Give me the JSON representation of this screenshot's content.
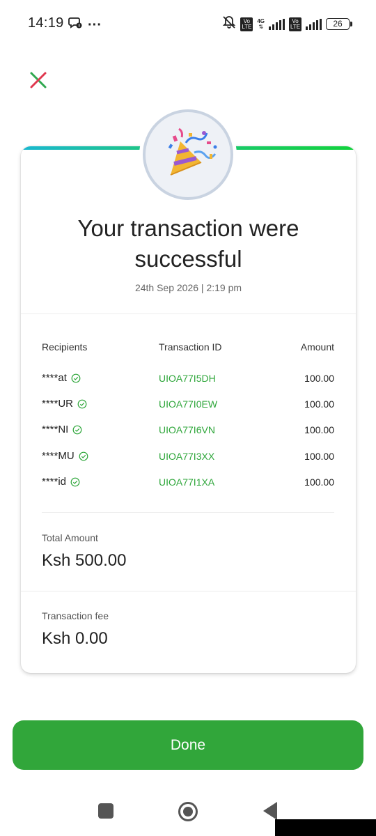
{
  "status_bar": {
    "time": "14:19",
    "more": "···",
    "volte1": "Vo LTE",
    "network": "4G",
    "volte2": "Vo LTE",
    "battery": "26"
  },
  "icons": {
    "close": "close-icon",
    "badge": "party-popper-icon",
    "check": "check-circle-icon"
  },
  "header": {
    "title_line1": "Your transaction were",
    "title_line2": "successful",
    "datetime": "24th Sep 2026 | 2:19 pm"
  },
  "table": {
    "headers": [
      "Recipients",
      "Transaction ID",
      "Amount"
    ],
    "rows": [
      {
        "recipient": "****at",
        "id": "UIOA77I5DH",
        "amount": "100.00"
      },
      {
        "recipient": "****UR",
        "id": "UIOA77I0EW",
        "amount": "100.00"
      },
      {
        "recipient": "****NI",
        "id": "UIOA77I6VN",
        "amount": "100.00"
      },
      {
        "recipient": "****MU",
        "id": "UIOA77I3XX",
        "amount": "100.00"
      },
      {
        "recipient": "****id",
        "id": "UIOA77I1XA",
        "amount": "100.00"
      }
    ]
  },
  "summary": {
    "total_label": "Total Amount",
    "total_value": "Ksh 500.00",
    "fee_label": "Transaction fee",
    "fee_value": "Ksh 0.00"
  },
  "actions": {
    "done_label": "Done"
  },
  "colors": {
    "accent_green": "#31a63a",
    "id_green": "#2ea63a",
    "close_red": "#e0384f",
    "close_green": "#2fa84f"
  }
}
